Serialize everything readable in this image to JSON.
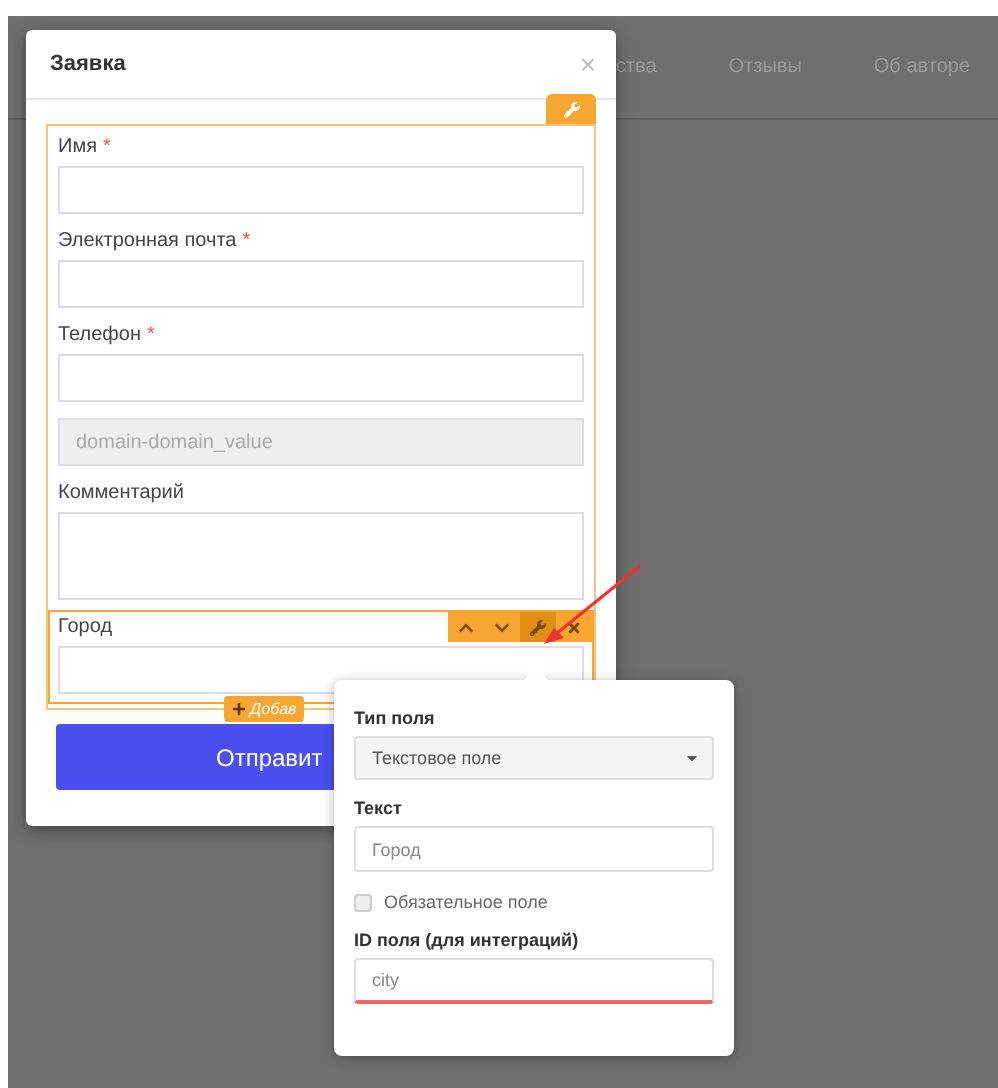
{
  "background": {
    "nav": [
      "ства",
      "Отзывы",
      "Об авторе"
    ]
  },
  "modal": {
    "title": "Заявка",
    "close": "×",
    "required_mark": "*",
    "fields": [
      {
        "label": "Имя",
        "required": true,
        "kind": "input",
        "selected": false
      },
      {
        "label": "Электронная почта",
        "required": true,
        "kind": "input",
        "selected": false
      },
      {
        "label": "Телефон",
        "required": true,
        "kind": "input",
        "selected": false
      },
      {
        "value": "domain-domain_value",
        "kind": "hidden",
        "selected": false
      },
      {
        "label": "Комментарий",
        "required": false,
        "kind": "textarea",
        "selected": false
      },
      {
        "label": "Город",
        "required": false,
        "kind": "input",
        "selected": true
      }
    ],
    "add_button": "Добав",
    "submit_button": "Отправит"
  },
  "popover": {
    "type_label": "Тип поля",
    "type_value": "Текстовое поле",
    "text_label": "Текст",
    "text_value": "Город",
    "required": {
      "label": "Обязательное поле",
      "checked": false
    },
    "id_label": "ID поля (для интеграций)",
    "id_value": "city"
  }
}
